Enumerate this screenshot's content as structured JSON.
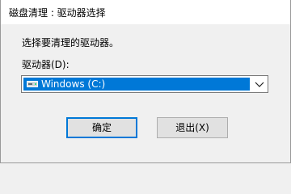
{
  "window": {
    "title": "磁盘清理 : 驱动器选择"
  },
  "dialog": {
    "prompt": "选择要清理的驱动器。",
    "drives_label": "驱动器(D):",
    "drive_select": {
      "selected": "Windows (C:)",
      "icon": "drive-icon"
    },
    "buttons": {
      "ok": "确定",
      "exit": "退出(X)"
    }
  },
  "colors": {
    "selection": "#0078d7",
    "background": "#f0f0f0"
  }
}
